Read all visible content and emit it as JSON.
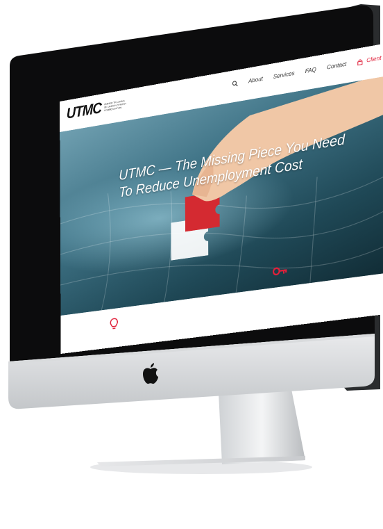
{
  "brand": {
    "logo": "UTMC",
    "tagline": "Unified Tracking of Unemployment Compensation"
  },
  "nav": {
    "items": [
      "About",
      "Services",
      "FAQ",
      "Contact"
    ],
    "signin": "Client Sign In"
  },
  "hero": {
    "line1": "UTMC — The Missing Piece You Need",
    "line2": "To Reduce Unemployment Cost"
  },
  "colors": {
    "accent": "#e0203a",
    "hero_dark": "#1f4856",
    "hero_light": "#6f9fb0"
  },
  "icons": [
    "search-icon",
    "lock-icon",
    "lightbulb-icon",
    "key-icon",
    "apple-logo-icon"
  ]
}
